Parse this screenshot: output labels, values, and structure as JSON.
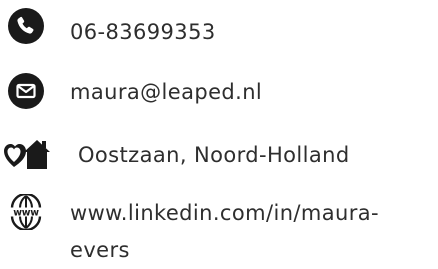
{
  "contact": {
    "phone": {
      "icon": "phone-icon",
      "text": "06-83699353"
    },
    "email": {
      "icon": "envelope-icon",
      "text": "maura@leaped.nl"
    },
    "location": {
      "icon": "home-heart-icon",
      "text": "Oostzaan, Noord-Holland"
    },
    "website": {
      "icon": "www-globe-icon",
      "text_line1": "www.linkedin.com/in/maura-",
      "text_line2": "evers"
    }
  },
  "colors": {
    "icon": "#1a1a1a",
    "text": "#2e2e2e",
    "background": "#ffffff"
  }
}
